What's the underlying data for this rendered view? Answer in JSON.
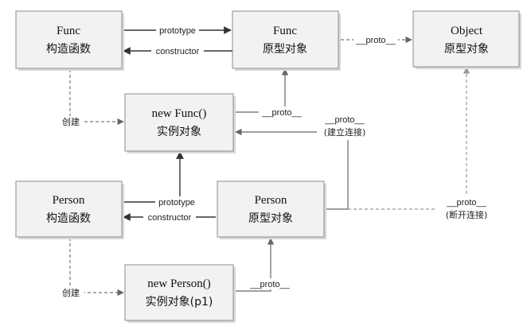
{
  "nodes": {
    "func_ctor": {
      "title": "Func",
      "subtitle": "构造函数"
    },
    "func_proto": {
      "title": "Func",
      "subtitle": "原型对象"
    },
    "object_proto": {
      "title": "Object",
      "subtitle": "原型对象"
    },
    "func_instance": {
      "title": "new Func()",
      "subtitle": "实例对象"
    },
    "person_ctor": {
      "title": "Person",
      "subtitle": "构造函数"
    },
    "person_proto": {
      "title": "Person",
      "subtitle": "原型对象"
    },
    "person_instance": {
      "title": "new Person()",
      "subtitle": "实例对象(p1)"
    }
  },
  "edges": {
    "func_prototype": "prototype",
    "func_constructor": "constructor",
    "funcproto_to_object": "__proto__",
    "funcinstance_to_funcproto": "__proto__",
    "create_func": "创建",
    "link_label": "__proto__",
    "link_note": "(建立连接)",
    "person_prototype": "prototype",
    "person_constructor": "constructor",
    "break_label": "__proto__",
    "break_note": "(断开连接)",
    "create_person": "创建",
    "personinstance_to_personproto": "__proto__"
  }
}
